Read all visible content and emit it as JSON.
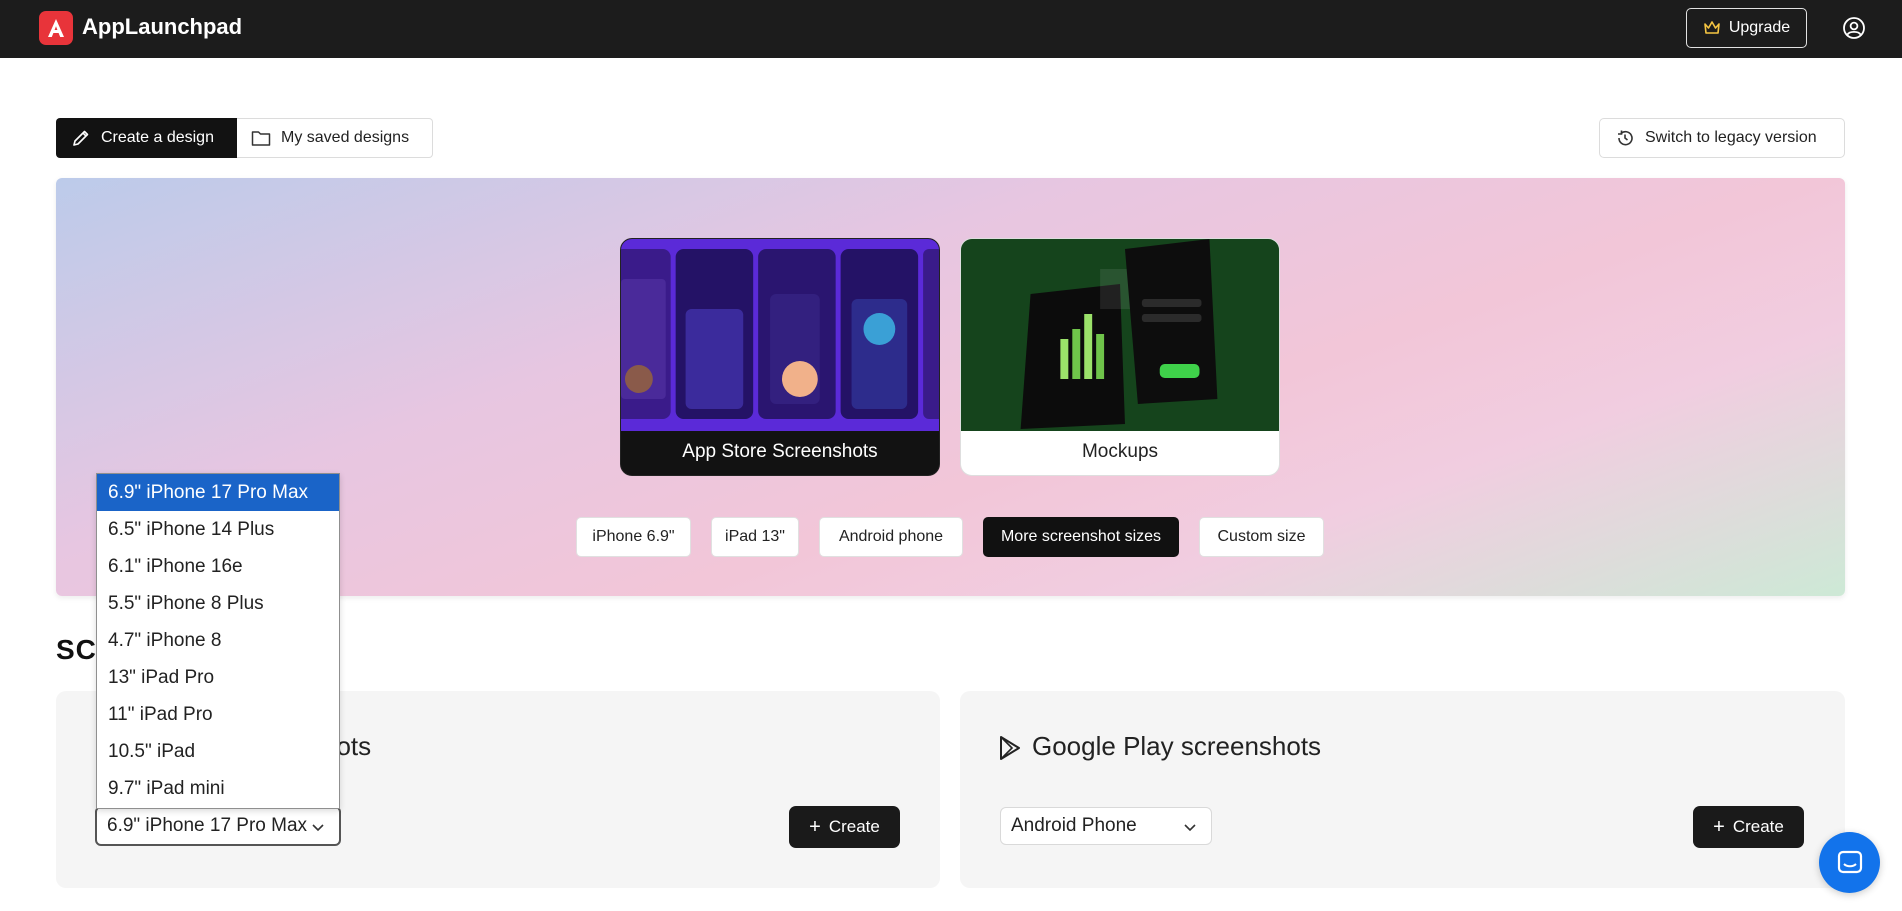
{
  "app": {
    "name": "AppLaunchpad"
  },
  "header": {
    "upgrade_label": "Upgrade"
  },
  "tabs": {
    "create_label": "Create a design",
    "saved_label": "My saved designs",
    "legacy_label": "Switch to legacy version"
  },
  "hero": {
    "cards": [
      {
        "label": "App Store Screenshots"
      },
      {
        "label": "Mockups"
      }
    ],
    "size_chips": [
      "iPhone 6.9\"",
      "iPad 13\"",
      "Android phone",
      "More screenshot sizes",
      "Custom size"
    ],
    "active_chip": "More screenshot sizes"
  },
  "section": {
    "title_visible": "SCR"
  },
  "apple_panel": {
    "title_visible": "hots",
    "selected_device": "6.9\" iPhone 17 Pro Max",
    "create_label": "Create"
  },
  "google_panel": {
    "title": "Google Play screenshots",
    "selected_device": "Android Phone",
    "create_label": "Create"
  },
  "dropdown": {
    "options": [
      "6.9\" iPhone 17 Pro Max",
      "6.5\" iPhone 14 Plus",
      "6.1\" iPhone 16e",
      "5.5\" iPhone 8 Plus",
      "4.7\" iPhone 8",
      "13\" iPad Pro",
      "11\" iPad Pro",
      "10.5\" iPad",
      "9.7\" iPad mini"
    ],
    "selected_index": 0
  },
  "colors": {
    "topbar": "#1c1c1c",
    "brand": "#e8343a",
    "selected": "#1a64c8",
    "chat": "#1273eb"
  },
  "icons": [
    "crown-icon",
    "account-icon",
    "pencil-icon",
    "folder-icon",
    "history-icon",
    "plus-icon",
    "chevron-down-icon",
    "google-play-icon",
    "chat-icon"
  ]
}
